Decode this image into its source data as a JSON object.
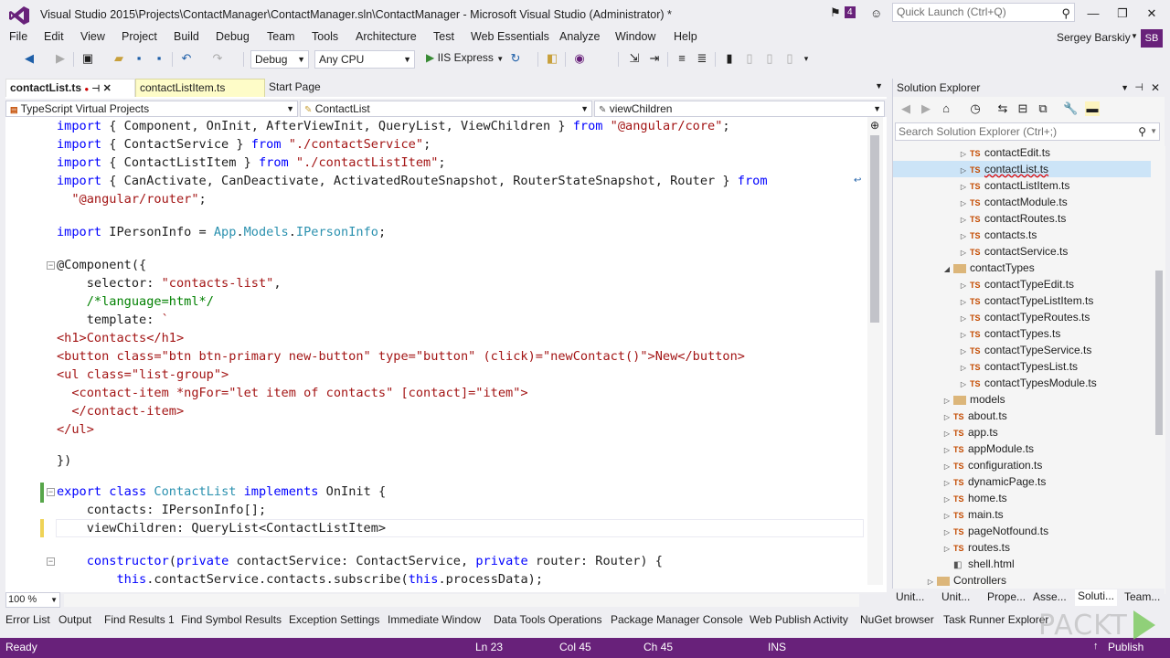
{
  "window": {
    "title": "Visual Studio 2015\\Projects\\ContactManager\\ContactManager.sln\\ContactManager - Microsoft Visual Studio (Administrator) *",
    "notification_count": "4",
    "quick_launch_placeholder": "Quick Launch (Ctrl+Q)",
    "user_name": "Sergey Barskiy",
    "user_initials": "SB"
  },
  "menu": [
    "File",
    "Edit",
    "View",
    "Project",
    "Build",
    "Debug",
    "Team",
    "Tools",
    "Architecture",
    "Test",
    "Web Essentials",
    "Analyze",
    "Window",
    "Help"
  ],
  "toolbar": {
    "configuration": "Debug",
    "platform": "Any CPU",
    "run_target": "IIS Express"
  },
  "tabs": [
    {
      "label": "contactList.ts",
      "state": "active"
    },
    {
      "label": "contactListItem.ts",
      "state": "preview"
    },
    {
      "label": "Start Page",
      "state": "normal"
    }
  ],
  "navbar": {
    "project": "TypeScript Virtual Projects",
    "type": "ContactList",
    "member": "viewChildren"
  },
  "code": {
    "l1": [
      "import",
      " { Component, OnInit, AfterViewInit, QueryList, ViewChildren } ",
      "from",
      " ",
      "\"@angular/core\"",
      ";"
    ],
    "l2": [
      "import",
      " { ContactService } ",
      "from",
      " ",
      "\"./contactService\"",
      ";"
    ],
    "l3": [
      "import",
      " { ContactListItem } ",
      "from",
      " ",
      "\"./contactListItem\"",
      ";"
    ],
    "l4": [
      "import",
      " { CanActivate, CanDeactivate, ActivatedRouteSnapshot, RouterStateSnapshot, Router } ",
      "from"
    ],
    "l5": [
      "  ",
      "\"@angular/router\"",
      ";"
    ],
    "l6": [
      "import",
      " IPersonInfo = ",
      "App",
      ".",
      "Models",
      ".",
      "IPersonInfo",
      ";"
    ],
    "l7": "@Component({",
    "l8": [
      "    selector: ",
      "\"contacts-list\"",
      ","
    ],
    "l9": [
      "    ",
      "/*language=html*/"
    ],
    "l10": [
      "    template: ",
      "`"
    ],
    "l11": "<h1>Contacts</h1>",
    "l12": "<button class=\"btn btn-primary new-button\" type=\"button\" (click)=\"newContact()\">New</button>",
    "l13": "<ul class=\"list-group\">",
    "l14": "  <contact-item *ngFor=\"let item of contacts\" [contact]=\"item\">",
    "l15": "  </contact-item>",
    "l16": "</ul>",
    "l17": "})",
    "l18": [
      "export",
      " ",
      "class",
      " ",
      "ContactList",
      " ",
      "implements",
      " OnInit {"
    ],
    "l19": [
      "    contacts: IPersonInfo[];"
    ],
    "l20": [
      "    viewChildren: QueryList<ContactListItem>"
    ],
    "l21": [
      "    ",
      "constructor",
      "(",
      "private",
      " contactService: ContactService, ",
      "private",
      " router: Router) {"
    ],
    "l22": [
      "        ",
      "this",
      ".contactService.contacts.subscribe(",
      "this",
      ".processData);"
    ]
  },
  "zoom": "100 %",
  "solution_explorer": {
    "title": "Solution Explorer",
    "search_placeholder": "Search Solution Explorer (Ctrl+;)",
    "items": [
      {
        "label": "contactEdit.ts",
        "kind": "ts",
        "level": 4,
        "expander": true
      },
      {
        "label": "contactList.ts",
        "kind": "ts",
        "level": 4,
        "expander": true,
        "selected": true
      },
      {
        "label": "contactListItem.ts",
        "kind": "ts",
        "level": 4,
        "expander": true
      },
      {
        "label": "contactModule.ts",
        "kind": "ts",
        "level": 4,
        "expander": true
      },
      {
        "label": "contactRoutes.ts",
        "kind": "ts",
        "level": 4,
        "expander": true
      },
      {
        "label": "contacts.ts",
        "kind": "ts",
        "level": 4,
        "expander": true
      },
      {
        "label": "contactService.ts",
        "kind": "ts",
        "level": 4,
        "expander": true
      },
      {
        "label": "contactTypes",
        "kind": "folder",
        "level": 3,
        "expander": true,
        "expanded": true
      },
      {
        "label": "contactTypeEdit.ts",
        "kind": "ts",
        "level": 4,
        "expander": true
      },
      {
        "label": "contactTypeListItem.ts",
        "kind": "ts",
        "level": 4,
        "expander": true
      },
      {
        "label": "contactTypeRoutes.ts",
        "kind": "ts",
        "level": 4,
        "expander": true
      },
      {
        "label": "contactTypes.ts",
        "kind": "ts",
        "level": 4,
        "expander": true
      },
      {
        "label": "contactTypeService.ts",
        "kind": "ts",
        "level": 4,
        "expander": true
      },
      {
        "label": "contactTypesList.ts",
        "kind": "ts",
        "level": 4,
        "expander": true
      },
      {
        "label": "contactTypesModule.ts",
        "kind": "ts",
        "level": 4,
        "expander": true
      },
      {
        "label": "models",
        "kind": "folder",
        "level": 3,
        "expander": true
      },
      {
        "label": "about.ts",
        "kind": "ts",
        "level": 3,
        "expander": true
      },
      {
        "label": "app.ts",
        "kind": "ts",
        "level": 3,
        "expander": true
      },
      {
        "label": "appModule.ts",
        "kind": "ts",
        "level": 3,
        "expander": true
      },
      {
        "label": "configuration.ts",
        "kind": "ts",
        "level": 3,
        "expander": true
      },
      {
        "label": "dynamicPage.ts",
        "kind": "ts",
        "level": 3,
        "expander": true
      },
      {
        "label": "home.ts",
        "kind": "ts",
        "level": 3,
        "expander": true
      },
      {
        "label": "main.ts",
        "kind": "ts",
        "level": 3,
        "expander": true
      },
      {
        "label": "pageNotfound.ts",
        "kind": "ts",
        "level": 3,
        "expander": true
      },
      {
        "label": "routes.ts",
        "kind": "ts",
        "level": 3,
        "expander": true
      },
      {
        "label": "shell.html",
        "kind": "html",
        "level": 3,
        "expander": false
      },
      {
        "label": "Controllers",
        "kind": "folder",
        "level": 2,
        "expander": true
      }
    ],
    "tabs": [
      "Unit...",
      "Unit...",
      "Prope...",
      "Asse...",
      "Soluti...",
      "Team..."
    ]
  },
  "bottom_tabs": [
    "Error List",
    "Output",
    "Find Results 1",
    "Find Symbol Results",
    "Exception Settings",
    "Immediate Window",
    "Data Tools Operations",
    "Package Manager Console",
    "Web Publish Activity",
    "NuGet browser",
    "Task Runner Explorer"
  ],
  "status": {
    "state": "Ready",
    "line": "Ln 23",
    "col": "Col 45",
    "ch": "Ch 45",
    "mode": "INS",
    "publish": "Publish"
  },
  "watermark": "PACKT"
}
